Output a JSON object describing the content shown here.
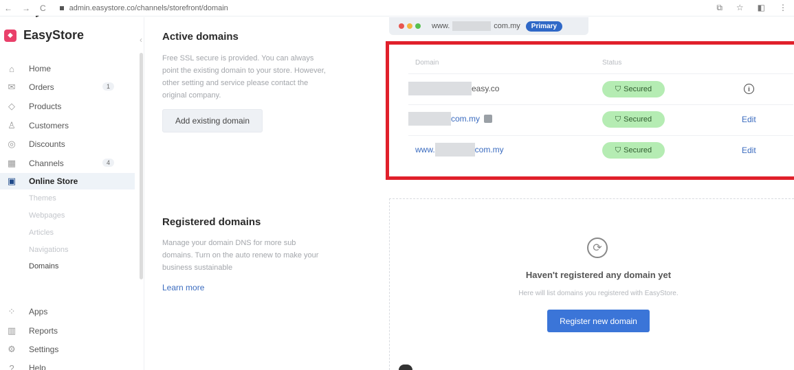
{
  "browser": {
    "nav_back": "←",
    "nav_forward": "→",
    "nav_reload": "C",
    "url": "admin.easystore.co/channels/storefront/domain",
    "right_icons": [
      "⧉",
      "☆",
      "◧",
      "⋮"
    ]
  },
  "brand": {
    "name": "EasyStore",
    "logo_glyph": "◆",
    "color": "#e9406a"
  },
  "sidebar": {
    "collapse_glyph": "‹",
    "items": [
      {
        "label": "Home",
        "icon": "home-icon",
        "glyph": "⌂"
      },
      {
        "label": "Orders",
        "icon": "orders-icon",
        "glyph": "✉",
        "badge": "1"
      },
      {
        "label": "Products",
        "icon": "tag-icon",
        "glyph": "◇"
      },
      {
        "label": "Customers",
        "icon": "user-icon",
        "glyph": "♙"
      },
      {
        "label": "Discounts",
        "icon": "discount-icon",
        "glyph": "◎"
      },
      {
        "label": "Channels",
        "icon": "store-icon",
        "glyph": "▦",
        "badge": "4"
      },
      {
        "label": "Online Store",
        "icon": "online-store-icon",
        "glyph": "▣"
      }
    ],
    "sub_items": [
      "Themes",
      "Webpages",
      "Articles",
      "Navigations",
      "Domains"
    ],
    "bottom_items": [
      {
        "label": "Apps",
        "icon": "apps-icon",
        "glyph": "⁘"
      },
      {
        "label": "Reports",
        "icon": "reports-icon",
        "glyph": "▥"
      },
      {
        "label": "Settings",
        "icon": "gear-icon",
        "glyph": "⚙"
      },
      {
        "label": "Help",
        "icon": "help-icon",
        "glyph": "?"
      }
    ]
  },
  "active_domains": {
    "title": "Active domains",
    "description": "Free SSL secure is provided. You can always point the existing domain to your store. However, other setting and service please contact the original company.",
    "add_button": "Add existing domain"
  },
  "registered_domains": {
    "title": "Registered domains",
    "description": "Manage your domain DNS for more sub domains. Turn on the auto renew to make your business sustainable",
    "learn_more": "Learn more"
  },
  "preview": {
    "www": "www.",
    "suffix": "com.my",
    "primary_label": "Primary"
  },
  "domain_table": {
    "headers": {
      "domain": "Domain",
      "status": "Status"
    },
    "rows": [
      {
        "domain_suffix": "easy.co",
        "status": "Secured",
        "action": "info",
        "is_link": false,
        "prefix": ""
      },
      {
        "domain_suffix": "com.my",
        "status": "Secured",
        "action": "Edit",
        "is_link": true,
        "prefix": ""
      },
      {
        "domain_suffix": "com.my",
        "status": "Secured",
        "action": "Edit",
        "is_link": true,
        "prefix": "www."
      }
    ],
    "secured_glyph": "⛉",
    "info_glyph": "i"
  },
  "empty_state": {
    "icon_glyph": "⟳",
    "title": "Haven't registered any domain yet",
    "description": "Here will list domains you registered with EasyStore.",
    "register_button": "Register new domain"
  },
  "colors": {
    "primary": "#3b75d8",
    "secured_bg": "#b5ecb3",
    "highlight_border": "#e0202b"
  }
}
